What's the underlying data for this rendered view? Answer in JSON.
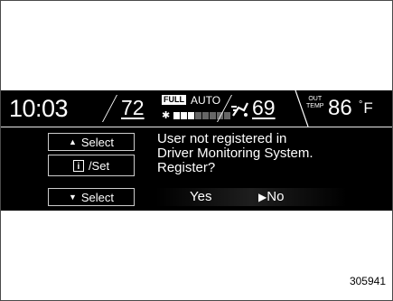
{
  "status_bar": {
    "clock": "10:03",
    "driver_temp": "72",
    "fan_mode_badge": "FULL",
    "climate_mode": "AUTO",
    "fan_level": 3,
    "fan_level_max": 8,
    "passenger_temp": "69",
    "outside_temp_label_line1": "OUT",
    "outside_temp_label_line2": "TEMP",
    "outside_temp": "86",
    "outside_temp_unit": "F"
  },
  "controls": {
    "up_select_label": "Select",
    "info_set_label": "/Set",
    "down_select_label": "Select"
  },
  "dialog": {
    "message_lines": [
      "User not registered in",
      "Driver Monitoring System.",
      "Register?"
    ],
    "yes_label": "Yes",
    "no_label": "No",
    "selected": "No"
  },
  "figure_id": "305941",
  "icons": {
    "up": "triangle-up-icon",
    "down": "triangle-down-icon",
    "info": "info-icon",
    "fan": "fan-icon",
    "airflow": "airflow-icon",
    "selection_pointer": "triangle-right-icon"
  },
  "colors": {
    "screen_bg": "#000000",
    "text": "#ffffff",
    "page_bg": "#ffffff"
  }
}
